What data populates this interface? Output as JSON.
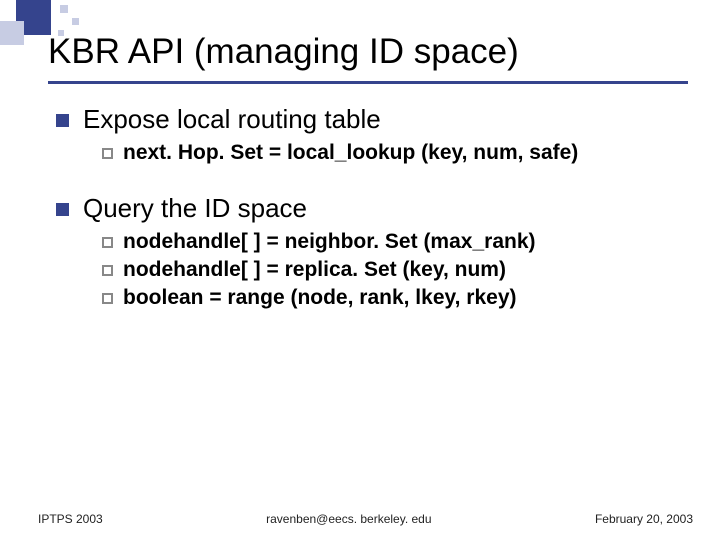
{
  "title": "KBR API (managing ID space)",
  "sections": [
    {
      "heading": "Expose local routing table",
      "items": [
        "next. Hop. Set = local_lookup (key, num, safe)"
      ]
    },
    {
      "heading": "Query the ID space",
      "items": [
        "nodehandle[ ] = neighbor. Set (max_rank)",
        "nodehandle[ ] = replica. Set (key, num)",
        "boolean = range (node, rank, lkey, rkey)"
      ]
    }
  ],
  "footer": {
    "left": "IPTPS 2003",
    "center": "ravenben@eecs. berkeley. edu",
    "right": "February 20, 2003"
  }
}
